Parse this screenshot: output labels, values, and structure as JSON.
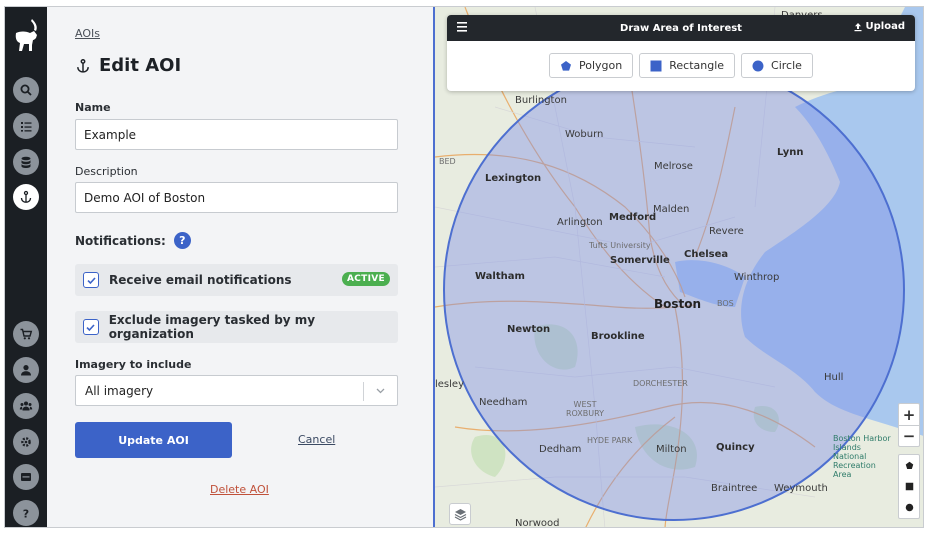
{
  "breadcrumb": {
    "label": "AOIs"
  },
  "page": {
    "title": "Edit AOI"
  },
  "form": {
    "name_label": "Name",
    "name_value": "Example",
    "description_label": "Description",
    "description_value": "Demo AOI of Boston",
    "notifications_label": "Notifications:",
    "help_icon": "?",
    "email_label": "Receive email notifications",
    "email_checked": true,
    "email_badge": "ACTIVE",
    "exclude_label": "Exclude imagery tasked by my organization",
    "exclude_checked": true,
    "imagery_label": "Imagery to include",
    "imagery_value": "All imagery",
    "update_label": "Update AOI",
    "cancel_label": "Cancel",
    "delete_label": "Delete AOI"
  },
  "sidebar": {
    "items": [
      {
        "name": "search-icon"
      },
      {
        "name": "list-icon"
      },
      {
        "name": "database-icon"
      },
      {
        "name": "anchor-icon",
        "active": true
      },
      {
        "name": "cart-icon"
      },
      {
        "name": "user-icon"
      },
      {
        "name": "team-icon"
      },
      {
        "name": "gear-icon"
      },
      {
        "name": "archive-icon"
      },
      {
        "name": "help-icon"
      }
    ]
  },
  "draw_panel": {
    "title": "Draw Area of Interest",
    "upload_label": "Upload",
    "tools": [
      {
        "label": "Polygon",
        "icon": "pentagon-icon"
      },
      {
        "label": "Rectangle",
        "icon": "square-icon"
      },
      {
        "label": "Circle",
        "icon": "circle-icon"
      }
    ]
  },
  "map": {
    "zoom_in": "+",
    "zoom_out": "−",
    "labels": {
      "danvers": "Danvers",
      "burlington": "Burlington",
      "woburn": "Woburn",
      "lynn": "Lynn",
      "lexington": "Lexington",
      "melrose": "Melrose",
      "medford": "Medford",
      "malden": "Malden",
      "arlington": "Arlington",
      "revere": "Revere",
      "tufts": "Tufts University",
      "somerville": "Somerville",
      "chelsea": "Chelsea",
      "winthrop": "Winthrop",
      "waltham": "Waltham",
      "boston": "Boston",
      "bos": "BOS",
      "bed": "BED",
      "newton": "Newton",
      "brookline": "Brookline",
      "wellesley": "lesley",
      "dorchester": "DORCHESTER",
      "hull": "Hull",
      "needham": "Needham",
      "west_roxbury": "WEST ROXBURY",
      "hyde_park": "HYDE PARK",
      "quincy": "Quincy",
      "dedham": "Dedham",
      "milton": "Milton",
      "harbor": "Boston Harbor Islands National Recreation Area",
      "braintree": "Braintree",
      "weymouth": "Weymouth",
      "norwood": "Norwood"
    },
    "colors": {
      "aoi_fill": "#7f8fe6",
      "aoi_stroke": "#4d6fd0",
      "water": "#a9c8ee",
      "land": "#e8ece0"
    }
  }
}
